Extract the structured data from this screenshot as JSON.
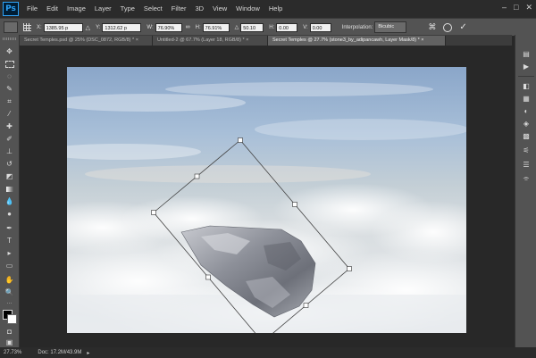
{
  "app": {
    "logo": "Ps"
  },
  "menu": [
    "File",
    "Edit",
    "Image",
    "Layer",
    "Type",
    "Select",
    "Filter",
    "3D",
    "View",
    "Window",
    "Help"
  ],
  "window_controls": [
    "–",
    "□",
    "✕"
  ],
  "options_bar": {
    "x_label": "X:",
    "x_value": "1385.95 p",
    "y_label": "Y:",
    "y_value": "1312.62 p",
    "w_label": "W:",
    "w_value": "76.90%",
    "link_icon": "∞",
    "h_label": "H:",
    "h_value": "76.91%",
    "angle_label": "△",
    "angle_value": "50.10",
    "hskew_label": "H:",
    "hskew_value": "0.00",
    "vskew_label": "V:",
    "vskew_value": "0.00",
    "interp_label": "Interpolation:",
    "interp_value": "Bicubic",
    "warp_icon": "⌘",
    "cancel_icon": "⃠",
    "commit_icon": "✓"
  },
  "tabs": [
    {
      "label": "Secret Temples.psd @ 25% (DSC_0872, RGB/8) *  ×",
      "active": false
    },
    {
      "label": "Untitled-2 @ 67.7% (Layer 18, RGB/8) *  ×",
      "active": false
    },
    {
      "label": "Secret Temples @ 27.7% (stone3_by_adipancawh, Layer Mask/8) *  ×",
      "active": true
    }
  ],
  "status": {
    "zoom": "27.73%",
    "doc": "Doc: 17.2M/43.9M",
    "arrow": "▸"
  },
  "colors": {
    "menubar": "#2b2b2b",
    "panel": "#535353",
    "workspace": "#282828",
    "accent": "#2fa3f7"
  }
}
